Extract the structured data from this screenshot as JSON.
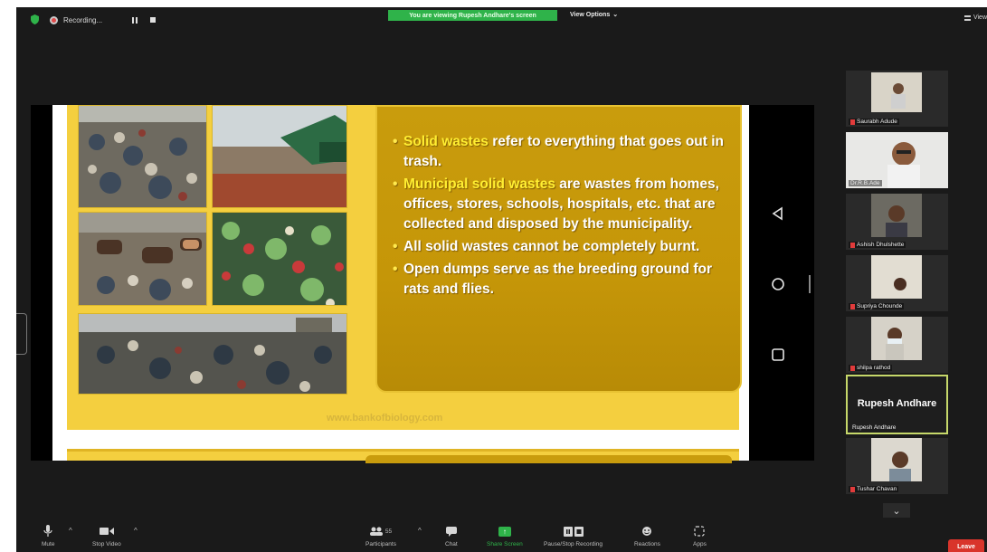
{
  "top_bar": {
    "recording_label": "Recording...",
    "banner_text": "You are viewing Rupesh Andhare's screen",
    "view_options_label": "View Options",
    "top_right_view_label": "View"
  },
  "colors": {
    "banner_green": "#2fb34a",
    "slide_yellow": "#f4cf3f",
    "text_panel": "#c99c0d",
    "bullet_highlight": "#ffee32",
    "leave_red": "#d9342b",
    "active_speaker_border": "#c6d86a"
  },
  "slide": {
    "bullets": [
      {
        "highlight": "Solid wastes",
        "text": " refer to everything that goes out in trash."
      },
      {
        "highlight": "Municipal solid wastes",
        "text": " are wastes from homes, offices, stores, schools, hospitals, etc. that are collected and disposed by the municipality."
      },
      {
        "highlight": "",
        "text": "All solid wastes cannot be completely burnt."
      },
      {
        "highlight": "",
        "text": "Open dumps serve as the breeding ground for rats and flies."
      }
    ],
    "footer_url": "www.bankofbiology.com"
  },
  "participants": [
    {
      "name": "Saurabh Adude",
      "muted": true
    },
    {
      "name": "Dr.R.B.Ade",
      "muted": false
    },
    {
      "name": "Ashish Dhulshette",
      "muted": true
    },
    {
      "name": "Supriya Chounde",
      "muted": true
    },
    {
      "name": "shilpa rathod",
      "muted": true
    },
    {
      "name": "Rupesh Andhare",
      "big_label": "Rupesh Andhare",
      "muted": false,
      "active": true
    },
    {
      "name": "Tushar Chavan",
      "muted": true
    }
  ],
  "toolbar": {
    "mute": "Mute",
    "stop_video": "Stop Video",
    "participants": "Participants",
    "participant_count": "55",
    "chat": "Chat",
    "share_screen": "Share Screen",
    "pause_stop_recording": "Pause/Stop Recording",
    "reactions": "Reactions",
    "apps": "Apps",
    "leave": "Leave"
  },
  "icons": [
    "shield-icon",
    "record-icon",
    "pause-icon",
    "stop-icon",
    "grid-icon",
    "back-triangle-icon",
    "home-circle-icon",
    "recents-square-icon",
    "chevron-down-icon",
    "mic-icon",
    "video-camera-icon",
    "participants-icon",
    "chat-bubble-icon",
    "share-screen-icon",
    "recording-icon",
    "reactions-icon",
    "apps-icon"
  ]
}
